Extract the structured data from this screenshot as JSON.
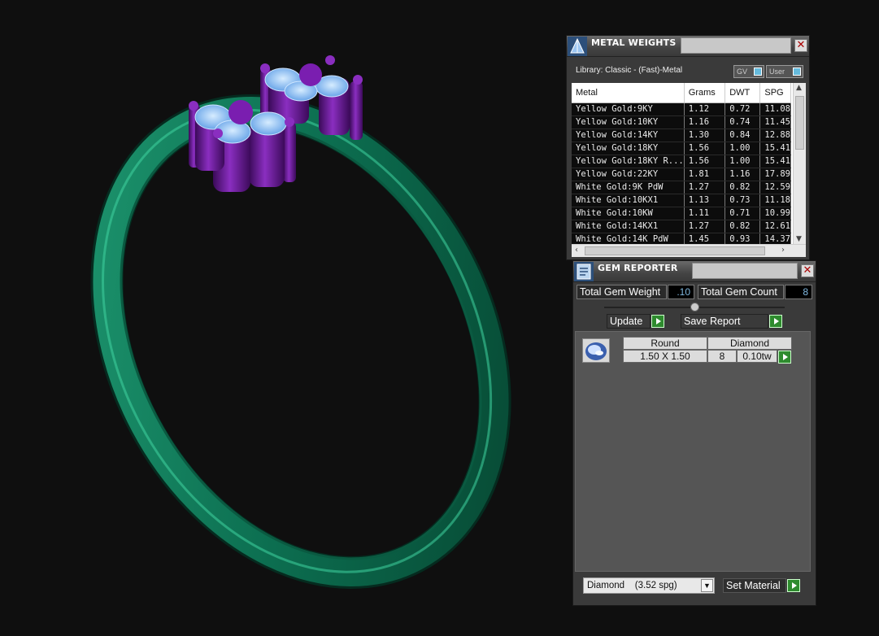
{
  "metal_weights": {
    "title": "METAL WEIGHTS",
    "library_label": "Library: Classic - (Fast)-Metal",
    "toggle_gv": "GV",
    "toggle_user": "User",
    "columns": [
      "Metal",
      "Grams",
      "DWT",
      "SPG"
    ],
    "rows": [
      [
        "Yellow Gold:9KY",
        "1.12",
        "0.72",
        "11.08"
      ],
      [
        "Yellow Gold:10KY",
        "1.16",
        "0.74",
        "11.45"
      ],
      [
        "Yellow Gold:14KY",
        "1.30",
        "0.84",
        "12.88"
      ],
      [
        "Yellow Gold:18KY",
        "1.56",
        "1.00",
        "15.41"
      ],
      [
        "Yellow Gold:18KY R...",
        "1.56",
        "1.00",
        "15.41"
      ],
      [
        "Yellow Gold:22KY",
        "1.81",
        "1.16",
        "17.89"
      ],
      [
        "White Gold:9K PdW",
        "1.27",
        "0.82",
        "12.59"
      ],
      [
        "White Gold:10KX1",
        "1.13",
        "0.73",
        "11.18"
      ],
      [
        "White Gold:10KW",
        "1.11",
        "0.71",
        "10.99"
      ],
      [
        "White Gold:14KX1",
        "1.27",
        "0.82",
        "12.61"
      ],
      [
        "White Gold:14K PdW",
        "1.45",
        "0.93",
        "14.37"
      ]
    ]
  },
  "gem_reporter": {
    "title": "GEM REPORTER",
    "total_weight_label": "Total Gem Weight",
    "total_weight_value": ".10",
    "total_count_label": "Total Gem Count",
    "total_count_value": "8",
    "update_label": "Update",
    "save_report_label": "Save Report",
    "gem": {
      "shape": "Round",
      "material": "Diamond",
      "size": "1.50 X 1.50",
      "count": "8",
      "weight": "0.10tw"
    },
    "material_select": "Diamond    (3.52 spg)",
    "set_material_label": "Set Material"
  },
  "colors": {
    "ring_band": "#0e6a4e",
    "metal_head": "#5a1282",
    "gem_color": "#8fc4ff",
    "panel_bg": "#3a3a3a",
    "action_green": "#2e8b2e"
  }
}
